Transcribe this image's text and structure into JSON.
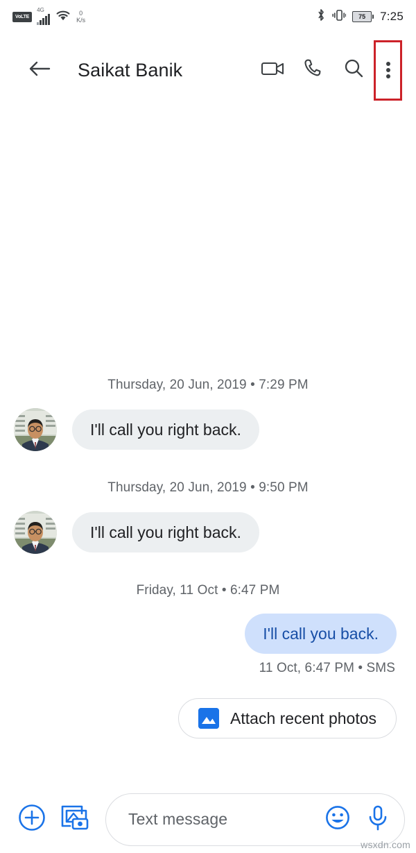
{
  "status_bar": {
    "volte_label": "VoLTE",
    "network_type": "4G",
    "data_speed_value": "0",
    "data_speed_unit": "K/s",
    "bluetooth_icon": "bluetooth-icon",
    "vibrate_icon": "vibrate-icon",
    "battery_percent": "75",
    "clock": "7:25"
  },
  "app_bar": {
    "back_icon": "back-arrow-icon",
    "title": "Saikat Banik",
    "video_call_icon": "video-call-icon",
    "voice_call_icon": "phone-call-icon",
    "search_icon": "search-icon",
    "overflow_icon": "more-vert-icon",
    "highlight_color": "#cc2229"
  },
  "thread": {
    "groups": [
      {
        "separator": "Thursday, 20 Jun, 2019 • 7:29 PM",
        "direction": "incoming",
        "avatar": "contact-avatar",
        "text": "I'll call you right back.",
        "status": ""
      },
      {
        "separator": "Thursday, 20 Jun, 2019 • 9:50 PM",
        "direction": "incoming",
        "avatar": "contact-avatar",
        "text": "I'll call you right back.",
        "status": ""
      },
      {
        "separator": "Friday, 11 Oct • 6:47 PM",
        "direction": "outgoing",
        "avatar": "",
        "text": "I'll call you back.",
        "status": "11 Oct, 6:47 PM • SMS"
      }
    ]
  },
  "suggestion_chip": {
    "icon": "photo-image-icon",
    "label": "Attach recent photos"
  },
  "compose": {
    "add_icon": "plus-circle-icon",
    "gallery_camera_icon": "gallery-camera-icon",
    "placeholder": "Text message",
    "emoji_icon": "emoji-smiley-icon",
    "mic_icon": "microphone-icon",
    "accent_color": "#1a73e8"
  },
  "watermark": {
    "text": "wsxdn.com"
  }
}
